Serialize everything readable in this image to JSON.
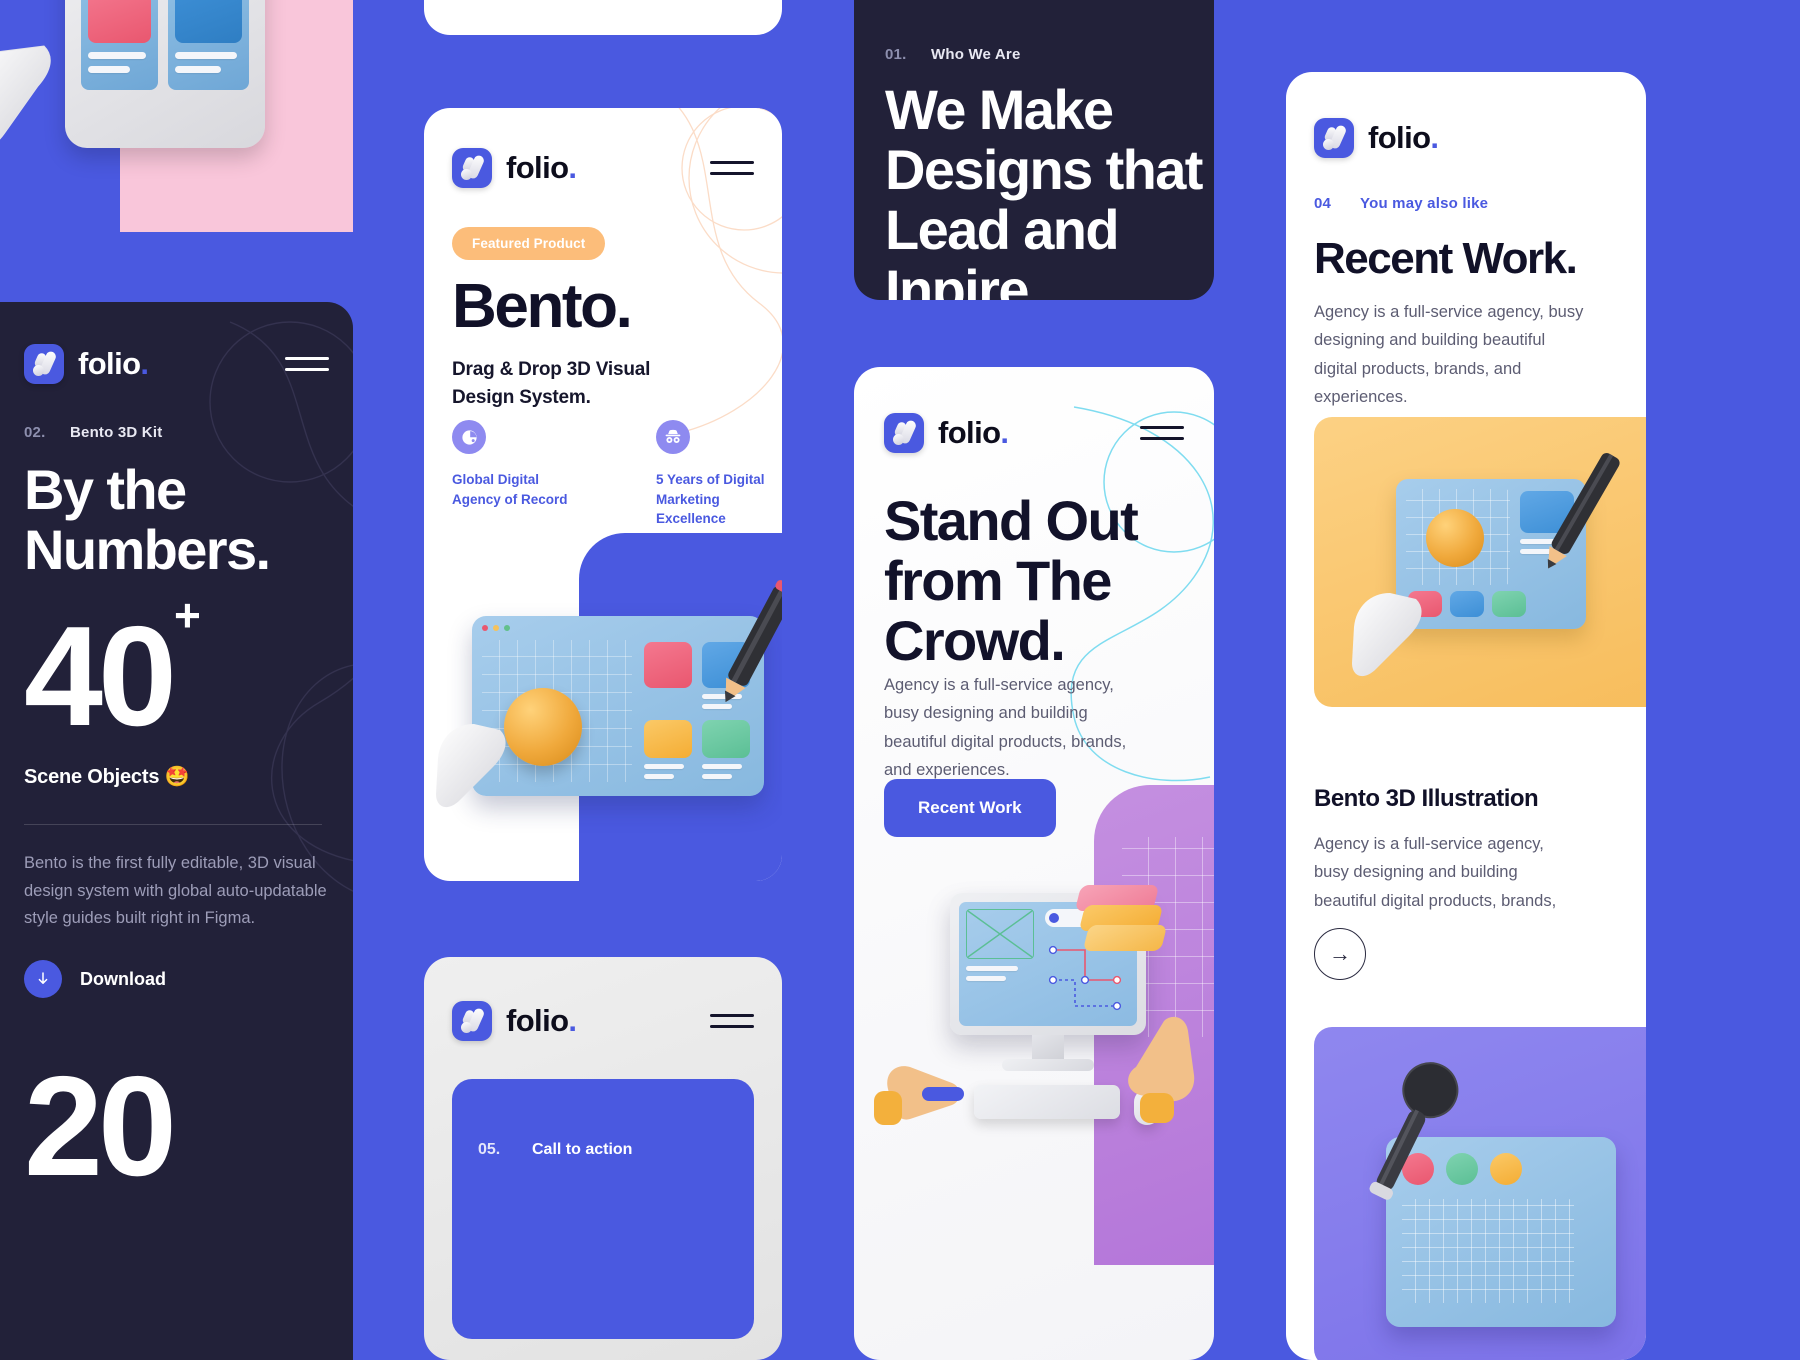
{
  "brand": {
    "name": "folio",
    "period": ".",
    "accent": "#4a59e0",
    "dark": "#222139",
    "amber": "#fcbd7a"
  },
  "card_numbers": {
    "logo": "folio",
    "eyebrow_num": "02.",
    "eyebrow_label": "Bento 3D Kit",
    "heading_line1": "By the",
    "heading_line2": "Numbers.",
    "stat_value": "40",
    "stat_sup": "+",
    "stat_label": "Scene Objects 🤩",
    "body": "Bento is the first fully editable, 3D visual design system with global auto-updatable style guides built right in Figma.",
    "download_label": "Download",
    "stat_value_2": "20"
  },
  "card_bento": {
    "logo": "folio",
    "badge": "Featured Product",
    "title": "Bento.",
    "subtitle_line1": "Drag & Drop 3D Visual",
    "subtitle_line2": "Design System.",
    "features": [
      {
        "icon": "pie-chart-icon",
        "text": "Global Digital Agency of Record"
      },
      {
        "icon": "incognito-icon",
        "text": "5 Years of Digital Marketing Excellence"
      }
    ]
  },
  "card_who": {
    "eyebrow_num": "01.",
    "eyebrow_label": "Who We Are",
    "heading_line1": "We Make",
    "heading_line2": "Designs that",
    "heading_line3": "Lead and",
    "heading_line4": "Inpire."
  },
  "card_stand_out": {
    "logo": "folio",
    "heading_line1": "Stand Out",
    "heading_line2": "from The",
    "heading_line3": "Crowd.",
    "body": "Agency is a full-service agency, busy designing and building beautiful digital products, brands, and experiences.",
    "button_label": "Recent Work"
  },
  "card_cta": {
    "logo": "folio",
    "cta_num": "05.",
    "cta_label": "Call to action"
  },
  "card_recent": {
    "logo": "folio",
    "eyebrow_num": "04",
    "eyebrow_label": "You may also like",
    "heading": "Recent Work.",
    "body": "Agency is a full-service agency, busy designing and building beautiful digital products, brands, and experiences.",
    "item_title": "Bento 3D Illustration",
    "item_body": "Agency is a full-service agency, busy designing and building beautiful digital products, brands,",
    "arrow": "→"
  }
}
